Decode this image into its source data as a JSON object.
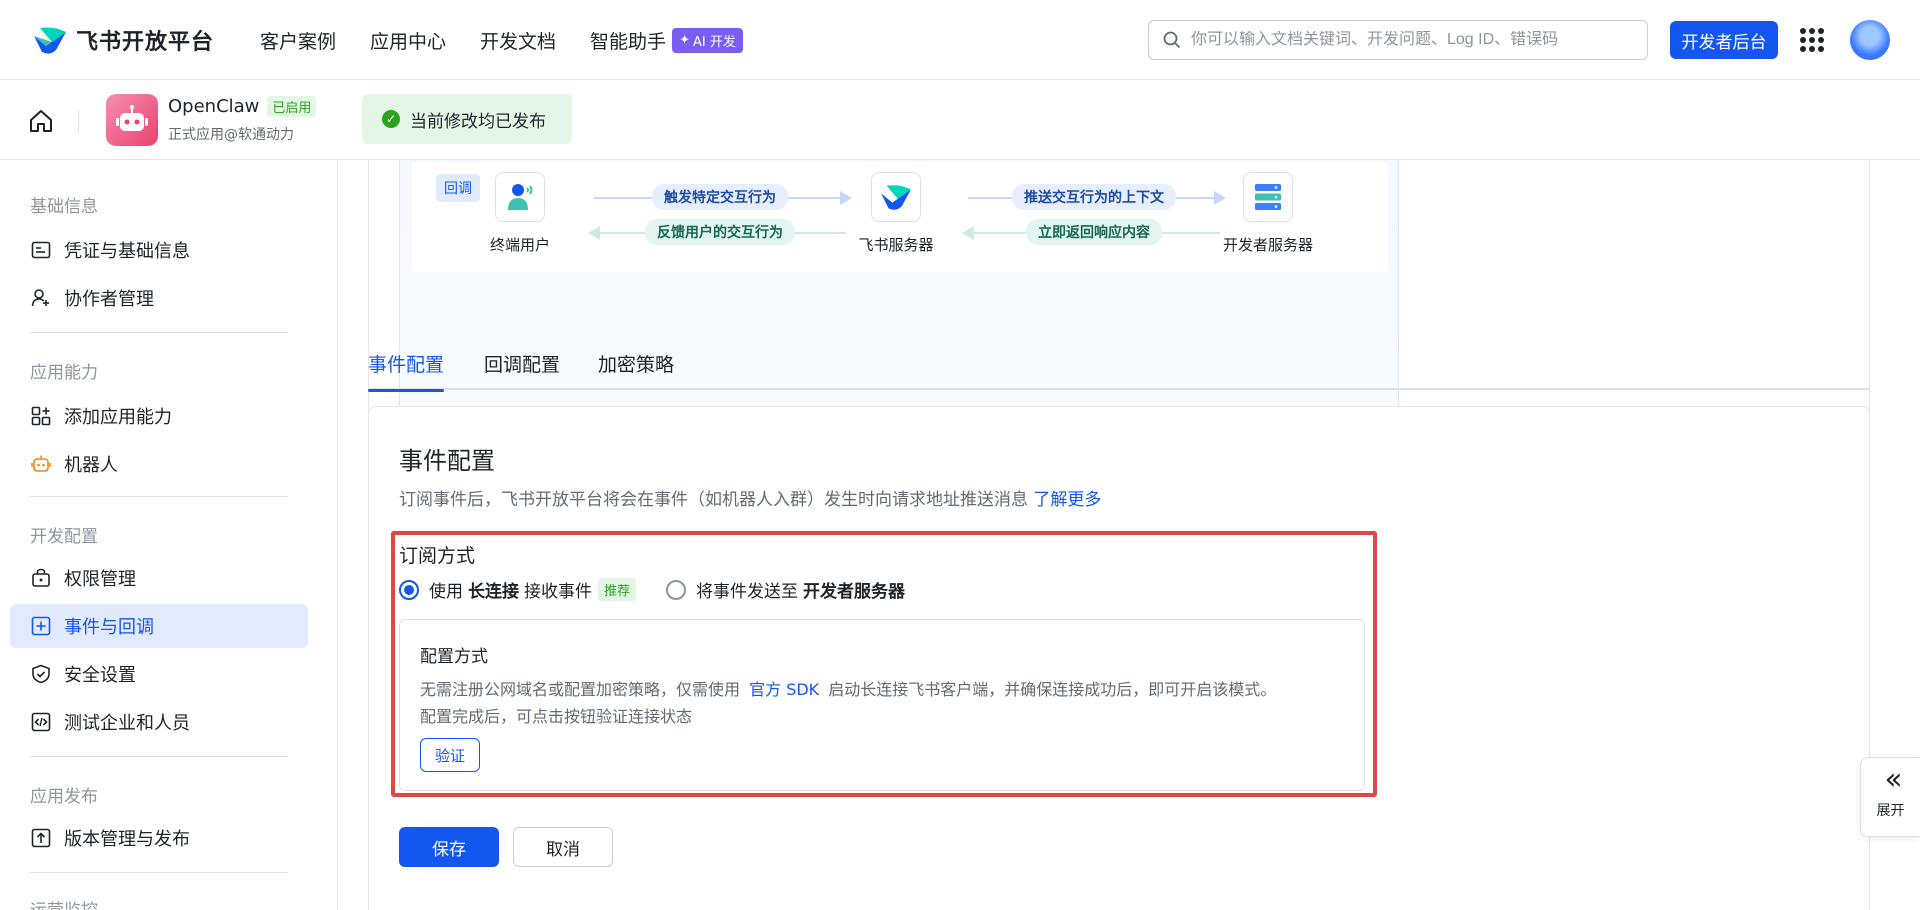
{
  "topnav": {
    "brand": "飞书开放平台",
    "links": [
      "客户案例",
      "应用中心",
      "开发文档",
      "智能助手"
    ],
    "ai_badge": "AI 开发",
    "search_placeholder": "你可以输入文档关键词、开发问题、Log ID、错误码",
    "dev_console": "开发者后台"
  },
  "appbar": {
    "app_name": "OpenClaw",
    "status": "已启用",
    "subtitle": "正式应用@软通动力",
    "publish_note": "当前修改均已发布"
  },
  "sidebar": {
    "groups": [
      "基础信息",
      "应用能力",
      "开发配置",
      "应用发布",
      "运营监控"
    ],
    "items": [
      {
        "label": "凭证与基础信息",
        "icon": "credential-icon"
      },
      {
        "label": "协作者管理",
        "icon": "user-add-icon"
      },
      {
        "label": "添加应用能力",
        "icon": "apps-add-icon"
      },
      {
        "label": "机器人",
        "icon": "robot-icon"
      },
      {
        "label": "权限管理",
        "icon": "lock-icon"
      },
      {
        "label": "事件与回调",
        "icon": "event-icon"
      },
      {
        "label": "安全设置",
        "icon": "shield-icon"
      },
      {
        "label": "测试企业和人员",
        "icon": "code-icon"
      },
      {
        "label": "版本管理与发布",
        "icon": "upload-icon"
      }
    ]
  },
  "diagram": {
    "tag": "回调",
    "nodes": [
      "终端用户",
      "飞书服务器",
      "开发者服务器"
    ],
    "flows": [
      "触发特定交互行为",
      "反馈用户的交互行为",
      "推送交互行为的上下文",
      "立即返回响应内容"
    ]
  },
  "tabs": [
    "事件配置",
    "回调配置",
    "加密策略"
  ],
  "event_config": {
    "title": "事件配置",
    "desc": "订阅事件后，飞书开放平台将会在事件（如机器人入群）发生时向请求地址推送消息",
    "learn_more": "了解更多",
    "subscribe_label": "订阅方式",
    "option1_prefix": "使用",
    "option1_bold": "长连接",
    "option1_suffix": "接收事件",
    "recommend": "推荐",
    "option2_prefix": "将事件发送至",
    "option2_bold": "开发者服务器",
    "config_title": "配置方式",
    "config_text_1": "无需注册公网域名或配置加密策略，仅需使用",
    "config_link": "官方 SDK",
    "config_text_2": "启动长连接飞书客户端，并确保连接成功后，即可开启该模式。",
    "config_text_3": "配置完成后，可点击按钮验证连接状态",
    "verify": "验证",
    "save": "保存",
    "cancel": "取消"
  },
  "expand_label": "展开",
  "colors": {
    "primary": "#1456f0",
    "success": "#2ea121",
    "highlight": "#e64545",
    "ai": "#7b5cf5"
  }
}
